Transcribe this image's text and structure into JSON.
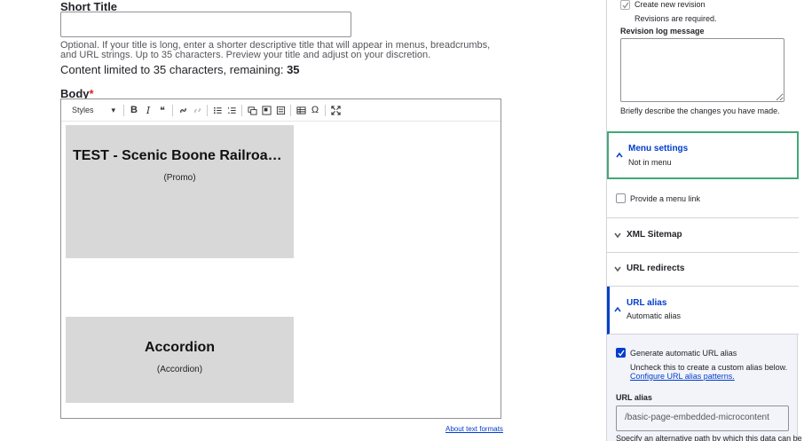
{
  "short_title": {
    "label": "Short Title",
    "value": "",
    "description": "Optional. If your title is long, enter a shorter descriptive title that will appear in menus, breadcrumbs, and URL strings. Up to 35 characters. Preview your title and adjust on your discretion.",
    "limit_text": "Content limited to 35 characters, remaining: ",
    "remaining": "35"
  },
  "body": {
    "label": "Body",
    "required_mark": "*",
    "toolbar": {
      "styles_label": "Styles",
      "dropdown_arrow": "▾",
      "bold": "B",
      "italic": "I",
      "quote": "❝",
      "special_char": "Ω"
    },
    "embeds": [
      {
        "title": "TEST - Scenic Boone Railroad Trai...",
        "type": "(Promo)"
      },
      {
        "title": "Accordion",
        "type": "(Accordion)"
      }
    ],
    "about_link": "About text formats"
  },
  "revision": {
    "checkbox_label": "Create new revision",
    "required_note": "Revisions are required.",
    "log_label": "Revision log message",
    "log_value": "",
    "log_help": "Briefly describe the changes you have made."
  },
  "menu_settings": {
    "title": "Menu settings",
    "summary": "Not in menu",
    "provide_link_label": "Provide a menu link"
  },
  "xml_sitemap": {
    "title": "XML Sitemap"
  },
  "url_redirects": {
    "title": "URL redirects"
  },
  "url_alias": {
    "title": "URL alias",
    "summary": "Automatic alias",
    "generate_label": "Generate automatic URL alias",
    "generate_help": "Uncheck this to create a custom alias below.",
    "configure_link": "Configure URL alias patterns.",
    "field_label": "URL alias",
    "field_value": "/basic-page-embedded-microcontent",
    "field_help": "Specify an alternative path by which this data can be"
  },
  "colors": {
    "accent": "#003ecc",
    "active_border": "#42a877",
    "required": "#dc2323"
  }
}
